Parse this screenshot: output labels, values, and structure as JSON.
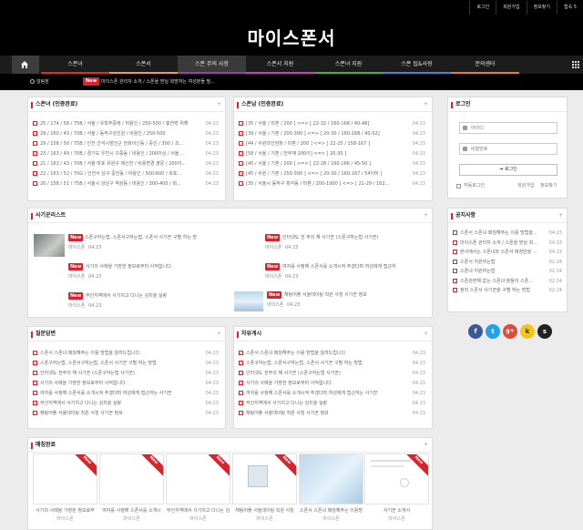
{
  "top_links": [
    "로그인",
    "회원가입",
    "정보찾기",
    "접속 5"
  ],
  "logo": "마이스폰서",
  "nav": {
    "items": [
      "스폰녀",
      "스폰서",
      "스폰 주의 사항",
      "스폰서 지원",
      "스폰녀 지원",
      "스폰 팁&사랑",
      "문의센터"
    ],
    "underline_colors": [
      "#e52b2b",
      "#f0a513",
      "#9a3fb6",
      "#d23cb4",
      "#3ab54a",
      "#2f8fdc",
      "#ee7a2a"
    ]
  },
  "ticker": {
    "label": "알림장",
    "new": "New",
    "text": "마이스폰 관리자 소개 / 스폰을 받실 희망하는 여성분들 필..."
  },
  "panels": {
    "sponnyeo": {
      "title": "스폰녀 (인증완료)",
      "rows": [
        {
          "text": "25 / 174 / 58 / 75B / 서울 / 유학주중에 / 비용인 / 250-500 / 충전력 위해",
          "date": "04.23"
        },
        {
          "text": "29 / 160 / 43 / 70B / 서울 / 동작구성인원 / 비용인 / 250-500",
          "date": "04.23"
        },
        {
          "text": "29 / 158 / 50 / 75B / 인천 간석시장인근 한화이신동 / 중인 / 300 / 조...",
          "date": "04.23"
        },
        {
          "text": "23 / 163 / 49 / 70B / 경기도 우친시 구증동 / 비용인 / 200이상 / 서울...",
          "date": "04.23"
        },
        {
          "text": "21 / 163 / 43 / 70B / 서울 마포 유원구 제신전 / 비용변경 영문 / 200이...",
          "date": "04.23"
        },
        {
          "text": "22 / 163 / 52 / 70G / 인천서 남구 중한동 / 비용인 / 500-600 / 회포...",
          "date": "04.23"
        },
        {
          "text": "20 / 158 / 51 / 75B / 서울시 강남구 역삼동 / 비용인 / 300-400 / 회...",
          "date": "04.23"
        }
      ]
    },
    "sponnam": {
      "title": "스폰남 (인증완료)",
      "rows": [
        {
          "text": "[35 / 서울 / 미혼 / 200 ] <=> [ 22-32 / 160-168 / 40-48]",
          "date": "04.23"
        },
        {
          "text": "[39 / 서울 / 기혼 / 200-300 ] <=> [ 20-30 / 160-168 / 40-52]",
          "date": "04.23"
        },
        {
          "text": "[44 / 수원과인암창 / 미혼 / 200 ] <=> [ 22-25 / 158-167 ]",
          "date": "04.23"
        },
        {
          "text": "[58 / 서울 / 기혼 / 전부재 200이] <=> [ 20-35 ]",
          "date": "04.23"
        },
        {
          "text": "[40 / 서울 / 기혼 / 200 ] <=> [ 22-28 / 160-166 / 45-50 ]",
          "date": "04.23"
        },
        {
          "text": "[45 / 수원 / 기혼 / 250-300 ] <=> [ 20-30 / 160-167 / 54이하 ]",
          "date": "04.23"
        },
        {
          "text": "[35 / 서울시 동작구 흑석동 / 미혼 / 200-1000 ] <=> [ 21-29 / 162...",
          "date": "04.23"
        }
      ]
    },
    "fraud": {
      "title": "사기꾼리스트",
      "items": [
        {
          "text": "스폰구하는법, 스폰서구하는법, 스폰서 사기꾼 구별 하는 방",
          "author": "마이스폰",
          "date": "04.23",
          "thumb": true
        },
        {
          "text": "인터넷도 전 주의 해 사기꾼 (스폰구하는법 사기꾼)",
          "author": "마이스폰",
          "date": "04.23",
          "thumb": false
        },
        {
          "text": "사기의 사례을 가장한 정보로부터 사적합니다.",
          "author": "마이스폰",
          "date": "04.23",
          "thumb": false
        },
        {
          "text": "여자를 사정해 스폰서를 소개시켜 주겠다며 여성에게 접근하",
          "author": "마이스폰",
          "date": "04.23",
          "thumb": false
        },
        {
          "text": "부산지역에서 사기치고 다니는 김치을 실랑",
          "author": "마이스폰",
          "date": "04.23",
          "thumb": false
        },
        {
          "text": "채팅어플 서울데이팅 직원 사칭 사기꾼 정보",
          "author": "마이스폰",
          "date": "04.23",
          "thumb": true
        }
      ]
    },
    "qna": {
      "title": "질문답변",
      "rows": [
        {
          "text": "스폰서 스폰녀 매칭해주는 이용 방법을 알려드립니다.",
          "date": "04.23"
        },
        {
          "text": "스폰구하는법, 스폰서구하는법, 스폰서 사기꾼 구별 하는 방법",
          "date": "04.23"
        },
        {
          "text": "인터넷도 전주의 해 사기꾼 (스폰구하는법 사기꾼)",
          "date": "04.23"
        },
        {
          "text": "사기의 사례을 가장한 정보로부터 사적합니다.",
          "date": "04.23"
        },
        {
          "text": "여자를 사정해 스폰서를 소개시켜 주겠다며 여성에게 접근하는 사기꾼",
          "date": "04.23"
        },
        {
          "text": "부산지역에서 사기치고 다니는 김치을 실랑",
          "date": "04.23"
        },
        {
          "text": "채팅어플 서울데이팅 직원 사칭 사기꾼 정보",
          "date": "04.23"
        }
      ]
    },
    "free": {
      "title": "자유게시",
      "rows": [
        {
          "text": "스폰서 스폰녀 매칭해주는 이용 방법을 알려드립니다.",
          "date": "04.23"
        },
        {
          "text": "스폰구하는법, 스폰서구하는법, 스폰서 사기꾼 구별 하는 방법",
          "date": "04.23"
        },
        {
          "text": "인터넷도 전주의 해 사기꾼 (스폰구하는법 사기꾼)",
          "date": "04.23"
        },
        {
          "text": "사기의 사례을 가장한 정보로부터 사적합니다.",
          "date": "04.23"
        },
        {
          "text": "여자를 사정해 스폰서를 소개시켜 주겠다며 여성에게 접근하는 사기꾼",
          "date": "04.23"
        },
        {
          "text": "부산지역에서 사기치고 다니는 김치을 실랑",
          "date": "04.23"
        },
        {
          "text": "채팅어플 서울데이팅 직원 사칭 사기꾼 정보",
          "date": "04.23"
        }
      ]
    },
    "matched": {
      "title": "매칭완료",
      "items": [
        {
          "caption": "사기의 사례을 가장된 정보로부",
          "author": "마이스폰",
          "image": "none",
          "ribbon": true
        },
        {
          "caption": "여자를 사정해 스폰서를 소개시",
          "author": "마이스폰",
          "image": "none",
          "ribbon": true
        },
        {
          "caption": "부산지역에서 사기치고 다니는 김",
          "author": "마이스폰",
          "image": "none",
          "ribbon": true
        },
        {
          "caption": "채팅어플 서울데이팅 직원 사칭",
          "author": "마이스폰",
          "image": "screen",
          "ribbon": true
        },
        {
          "caption": "스폰서 스폰녀 매칭해주는 이용방",
          "author": "마이스폰",
          "image": "blue",
          "ribbon": false
        },
        {
          "caption": "사기꾼 소개서",
          "author": "마이스폰",
          "image": "doc",
          "ribbon": true
        }
      ]
    }
  },
  "login": {
    "title": "로그인",
    "id_placeholder": "아이디",
    "pw_placeholder": "비밀번호",
    "button": "로그인",
    "auto": "자동로그인",
    "join": "회원가입",
    "find": "정보찾기"
  },
  "notice": {
    "title": "공지사항",
    "rows": [
      {
        "text": "스폰서 스폰녀 매칭해주는 이용 방법을...",
        "date": "04.23"
      },
      {
        "text": "마이스폰 관리자 소개 / 스폰을 받실 희...",
        "date": "04.23"
      },
      {
        "text": "본사에서는 스폰녀와 스폰서 매칭만을 ...",
        "date": "04.23"
      },
      {
        "text": "스폰서 지원하는법",
        "date": "02.24"
      },
      {
        "text": "스폰녀 지원하는법",
        "date": "02.24"
      },
      {
        "text": "스폰관련해 없는 스폰녀 분들의 스폰...",
        "date": "02.24"
      },
      {
        "text": "정직 스폰서 사기꾼을 구별 하는 방법",
        "date": "02.24"
      }
    ]
  },
  "social": [
    {
      "icon": "facebook-icon",
      "glyph": "f",
      "color": "#3b5998"
    },
    {
      "icon": "twitter-icon",
      "glyph": "t",
      "color": "#1da1f2"
    },
    {
      "icon": "google-plus-icon",
      "glyph": "g+",
      "color": "#dd4b39"
    },
    {
      "icon": "kakao-icon",
      "glyph": "k",
      "color": "#f5c518"
    },
    {
      "icon": "kakaostory-icon",
      "glyph": "s",
      "color": "#222222"
    }
  ],
  "labels": {
    "new": "New",
    "more": "+"
  }
}
